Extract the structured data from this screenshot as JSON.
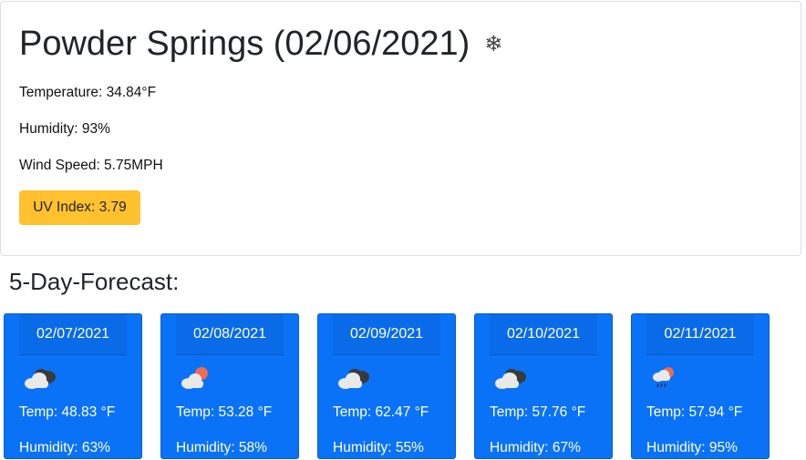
{
  "current": {
    "title": "Powder Springs (02/06/2021)",
    "weather_icon": "snowflake-icon",
    "temperature": "Temperature: 34.84°F",
    "humidity": "Humidity: 93%",
    "wind_speed": "Wind Speed: 5.75MPH",
    "uv_index": "UV Index: 3.79",
    "uv_color": "#ffc12e"
  },
  "forecast_heading": "5-Day-Forecast:",
  "forecast": [
    {
      "date": "02/07/2021",
      "icon": "cloudy-icon",
      "temp": "Temp: 48.83 °F",
      "humidity": "Humidity: 63%"
    },
    {
      "date": "02/08/2021",
      "icon": "partly-cloudy-sun-icon",
      "temp": "Temp: 53.28 °F",
      "humidity": "Humidity: 58%"
    },
    {
      "date": "02/09/2021",
      "icon": "cloudy-icon",
      "temp": "Temp: 62.47 °F",
      "humidity": "Humidity: 55%"
    },
    {
      "date": "02/10/2021",
      "icon": "cloudy-icon",
      "temp": "Temp: 57.76 °F",
      "humidity": "Humidity: 67%"
    },
    {
      "date": "02/11/2021",
      "icon": "rain-sun-icon",
      "temp": "Temp: 57.94 °F",
      "humidity": "Humidity: 95%"
    }
  ],
  "colors": {
    "card_blue": "#0a72f7",
    "uv_moderate": "#ffc12e"
  }
}
